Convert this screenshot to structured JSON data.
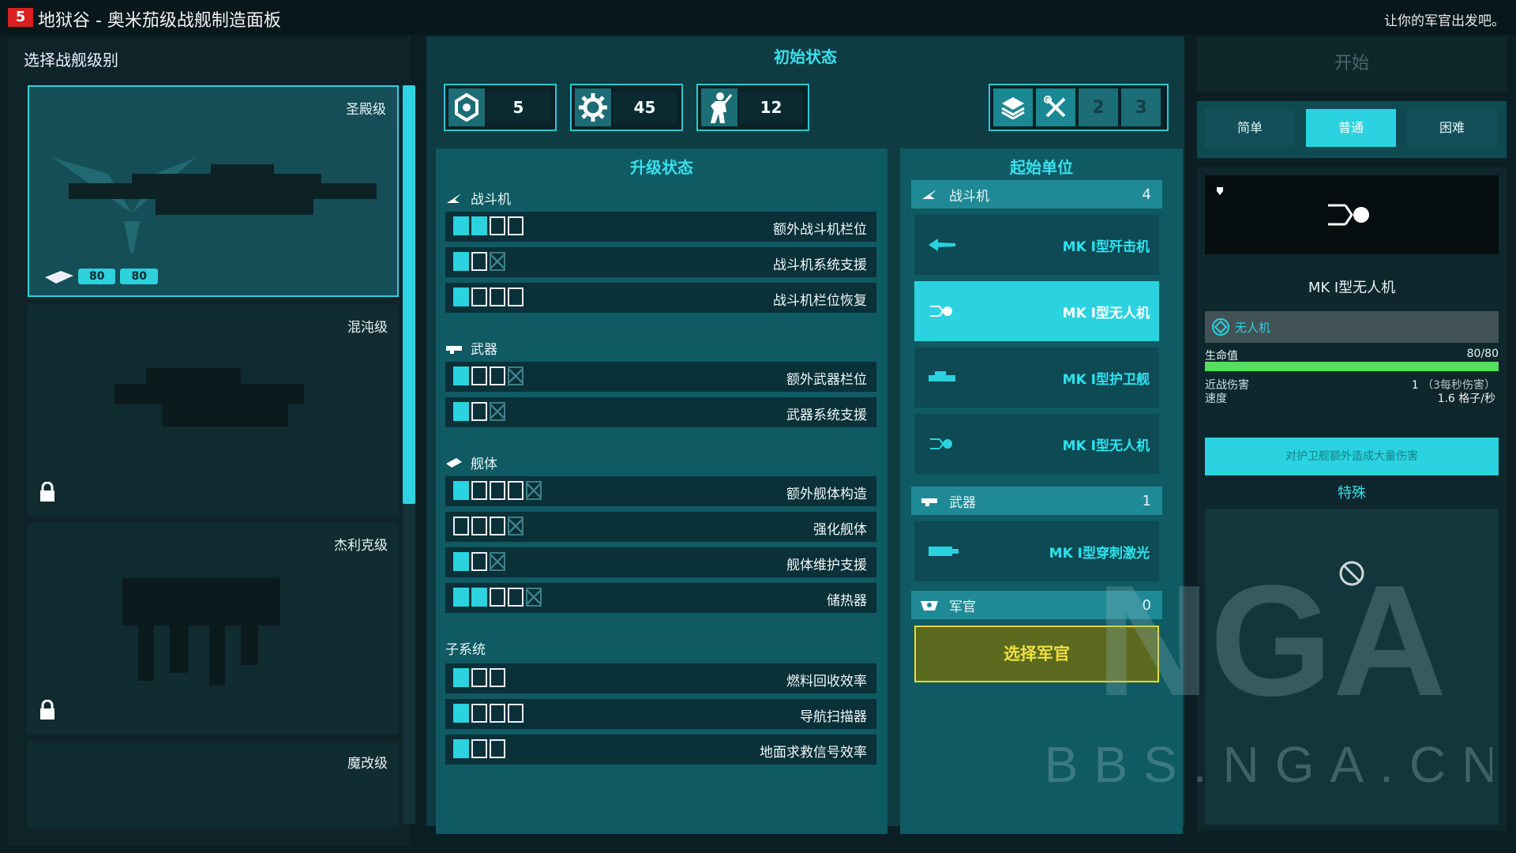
{
  "window": {
    "title": "地狱谷 - 奥米茄级战舰制造面板",
    "hint": "让你的军官出发吧。"
  },
  "ships": {
    "header": "选择战舰级别",
    "classes": [
      {
        "name": "圣殿级",
        "hull_badges": [
          "80",
          "80"
        ]
      },
      {
        "name": "混沌级"
      },
      {
        "name": "杰利克级"
      },
      {
        "name": "魔改级"
      }
    ]
  },
  "initial": {
    "title": "初始状态",
    "stats": [
      {
        "icon": "parts-icon",
        "value": "5"
      },
      {
        "icon": "gear-icon",
        "value": "45"
      },
      {
        "icon": "crew-icon",
        "value": "12"
      }
    ],
    "tool_slots": [
      "2",
      "3"
    ]
  },
  "upgrades": {
    "title": "升级状态",
    "sections": [
      {
        "title": "战斗机",
        "icon": "fighter-icon",
        "rows": [
          {
            "label": "额外战斗机栏位",
            "cells": [
              "f",
              "f",
              "e",
              "e"
            ]
          },
          {
            "label": "战斗机系统支援",
            "cells": [
              "f",
              "e",
              "x"
            ]
          },
          {
            "label": "战斗机栏位恢复",
            "cells": [
              "f",
              "e",
              "e",
              "e"
            ]
          }
        ]
      },
      {
        "title": "武器",
        "icon": "weapon-icon",
        "rows": [
          {
            "label": "额外武器栏位",
            "cells": [
              "f",
              "e",
              "e",
              "x"
            ]
          },
          {
            "label": "武器系统支援",
            "cells": [
              "f",
              "e",
              "x"
            ]
          }
        ]
      },
      {
        "title": "舰体",
        "icon": "hull-icon",
        "rows": [
          {
            "label": "额外舰体构造",
            "cells": [
              "f",
              "e",
              "e",
              "e",
              "x"
            ]
          },
          {
            "label": "强化舰体",
            "cells": [
              "e",
              "e",
              "e",
              "x"
            ]
          },
          {
            "label": "舰体维护支援",
            "cells": [
              "f",
              "e",
              "x"
            ]
          },
          {
            "label": "储热器",
            "cells": [
              "f",
              "f",
              "e",
              "e",
              "x"
            ]
          }
        ]
      },
      {
        "title": "子系统",
        "icon": "",
        "rows": [
          {
            "label": "燃料回收效率",
            "cells": [
              "f",
              "e",
              "e"
            ]
          },
          {
            "label": "导航扫描器",
            "cells": [
              "f",
              "e",
              "e",
              "e"
            ]
          },
          {
            "label": "地面求救信号效率",
            "cells": [
              "f",
              "e",
              "e"
            ]
          }
        ]
      }
    ]
  },
  "units": {
    "title": "起始单位",
    "fighters": {
      "label": "战斗机",
      "count": "4",
      "items": [
        "MK Ⅰ型歼击机",
        "MK Ⅰ型无人机",
        "MK Ⅰ型护卫舰",
        "MK Ⅰ型无人机"
      ]
    },
    "weapons": {
      "label": "武器",
      "count": "1",
      "items": [
        "MK Ⅰ型穿刺激光"
      ]
    },
    "officers": {
      "label": "军官",
      "count": "0"
    },
    "select_officer": "选择军官"
  },
  "right": {
    "start": "开始",
    "difficulty": [
      "简单",
      "普通",
      "困难"
    ],
    "selected_difficulty": 1,
    "detail": {
      "name": "MK Ⅰ型无人机",
      "tag": "无人机",
      "hp_label": "生命值",
      "hp_value": "80/80",
      "hp_fraction": 1.0,
      "melee_label": "近战伤害",
      "speed_label": "速度",
      "melee_value": "1",
      "melee_note": "（3每秒伤害）",
      "speed_value": "1.6 格子/秒",
      "desc": "对护卫舰额外造成大量伤害",
      "special": "特殊"
    }
  },
  "watermark": {
    "big": "NGA",
    "url": "BBS.NGA.CN"
  },
  "colors": {
    "accent": "#2ad3df",
    "officer_btn": "#f1df3f",
    "hp": "#53e05d"
  }
}
